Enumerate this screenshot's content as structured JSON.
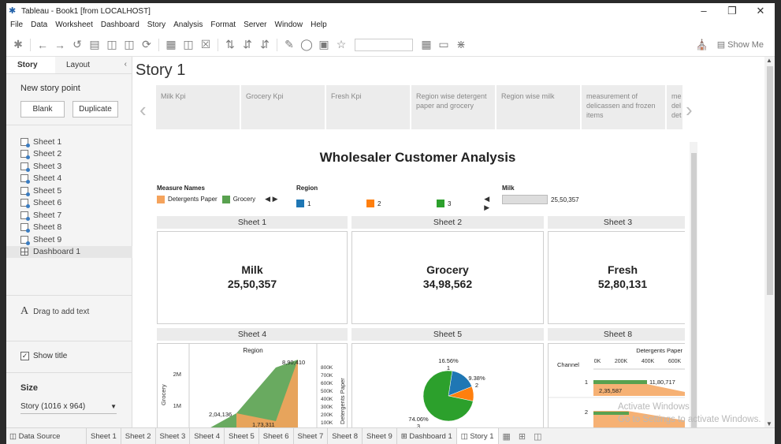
{
  "window": {
    "title": "Tableau - Book1 [from LOCALHOST]",
    "controls": [
      "–",
      "❐",
      "✕"
    ]
  },
  "menu": [
    "File",
    "Data",
    "Worksheet",
    "Dashboard",
    "Story",
    "Analysis",
    "Format",
    "Server",
    "Window",
    "Help"
  ],
  "toolbar": {
    "show_me_label": "Show Me"
  },
  "sidebar": {
    "tabs": [
      "Story",
      "Layout"
    ],
    "new_story_point_label": "New story point",
    "blank_label": "Blank",
    "duplicate_label": "Duplicate",
    "sheets": [
      "Sheet 1",
      "Sheet 2",
      "Sheet 3",
      "Sheet 4",
      "Sheet 5",
      "Sheet 6",
      "Sheet 7",
      "Sheet 8",
      "Sheet 9",
      "Dashboard 1"
    ],
    "drag_text_icon": "A",
    "drag_text_label": "Drag to add text",
    "show_title_label": "Show title",
    "show_title_checked": true,
    "size_label": "Size",
    "size_value": "Story (1016 x 964)"
  },
  "story": {
    "title": "Story 1",
    "points": [
      "Milk Kpi",
      "Grocery Kpi",
      "Fresh Kpi",
      "Region wise detergent paper and grocery",
      "Region wise milk",
      "measurement of delicassen and frozen items",
      "me del det"
    ]
  },
  "dashboard": {
    "title": "Wholesaler Customer Analysis",
    "legend_measure": {
      "header": "Measure Names",
      "items": [
        {
          "label": "Detergents Paper",
          "color": "#f5a35c"
        },
        {
          "label": "Grocery",
          "color": "#59a14f"
        }
      ]
    },
    "legend_region": {
      "header": "Region",
      "items": [
        {
          "label": "1",
          "color": "#1f77b4"
        },
        {
          "label": "2",
          "color": "#ff7f0e"
        },
        {
          "label": "3",
          "color": "#2ca02c"
        }
      ]
    },
    "legend_milk": {
      "header": "Milk",
      "value": "25,50,357"
    },
    "sheet_headers": [
      "Sheet 1",
      "Sheet 2",
      "Sheet 3",
      "Sheet 4",
      "Sheet 5",
      "Sheet 8"
    ],
    "kpis": [
      {
        "name": "Milk",
        "value": "25,50,357"
      },
      {
        "name": "Grocery",
        "value": "34,98,562"
      },
      {
        "name": "Fresh",
        "value": "52,80,131"
      }
    ]
  },
  "chart_data": [
    {
      "type": "area",
      "title": "Region",
      "ylabel": "Grocery",
      "y2label": "Detergents Paper",
      "y_ticks": [
        "2M",
        "1M"
      ],
      "y2_ticks": [
        "800K",
        "700K",
        "600K",
        "500K",
        "400K",
        "300K",
        "200K",
        "100K"
      ],
      "data_labels": [
        "8,90,410",
        "2,04,136",
        "1,73,311"
      ],
      "series": [
        {
          "name": "Grocery",
          "color": "#59a14f"
        },
        {
          "name": "Detergents Paper",
          "color": "#f5a35c"
        }
      ]
    },
    {
      "type": "pie",
      "slices": [
        {
          "label": "1",
          "percent": 16.56,
          "percent_label": "16.56%",
          "color": "#1f77b4"
        },
        {
          "label": "2",
          "percent": 9.38,
          "percent_label": "9.38%",
          "color": "#ff7f0e"
        },
        {
          "label": "3",
          "percent": 74.06,
          "percent_label": "74.06%",
          "color": "#2ca02c"
        }
      ]
    },
    {
      "type": "bar",
      "title": "Detergents Paper",
      "ylabel": "Channel",
      "x_ticks": [
        "0K",
        "200K",
        "400K",
        "600K"
      ],
      "categories": [
        "1",
        "2"
      ],
      "data_labels": [
        "11,80,717",
        "2,35,587"
      ],
      "series": [
        {
          "name": "Detergents Paper",
          "color": "#f5a35c"
        },
        {
          "name": "Grocery",
          "color": "#59a14f"
        }
      ]
    }
  ],
  "tabs": [
    "Sheet 1",
    "Sheet 2",
    "Sheet 3",
    "Sheet 4",
    "Sheet 5",
    "Sheet 6",
    "Sheet 7",
    "Sheet 8",
    "Sheet 9",
    "Dashboard 1",
    "Story 1"
  ],
  "data_source_label": "Data Source",
  "active_tab": "Story 1",
  "watermark": {
    "line1": "Activate Windows",
    "line2": "Go to Settings to activate Windows."
  }
}
